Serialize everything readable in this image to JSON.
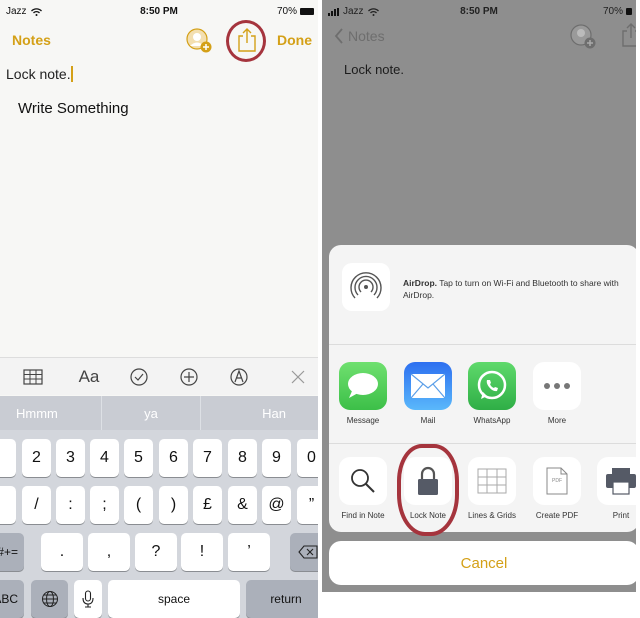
{
  "left_screen": {
    "status_bar": {
      "carrier": "Jazz",
      "time": "8:50 PM",
      "battery": "70%"
    },
    "navbar": {
      "back_label": "Notes",
      "done_label": "Done"
    },
    "note": {
      "title": "Lock note.",
      "body": "Write Something"
    },
    "toolbar": {
      "format_label": "Aa"
    },
    "suggestions": [
      "Hmmm",
      "ya",
      "Han"
    ],
    "keyboard": {
      "row1": [
        "2",
        "3",
        "4",
        "5",
        "6",
        "7",
        "8",
        "9",
        "0"
      ],
      "row2": [
        "/",
        ":",
        ";",
        "(",
        ")",
        "£",
        "&",
        "@",
        "”"
      ],
      "row3": [
        ".",
        ",",
        "?",
        "!",
        "’"
      ],
      "symbols_key": "#+=",
      "abc_key": "ABC",
      "space_key": "space",
      "return_key": "return"
    }
  },
  "right_screen": {
    "status_bar": {
      "carrier": "Jazz",
      "time": "8:50 PM",
      "battery": "70%"
    },
    "navbar": {
      "back_label": "Notes"
    },
    "note": {
      "title": "Lock note."
    },
    "share_sheet": {
      "airdrop_title": "AirDrop.",
      "airdrop_text": " Tap to turn on Wi-Fi and Bluetooth to share with AirDrop.",
      "apps": [
        {
          "label": "Message",
          "icon": "message-icon",
          "color": "#4cd964"
        },
        {
          "label": "Mail",
          "icon": "mail-icon",
          "color": "#1d7cf2"
        },
        {
          "label": "WhatsApp",
          "icon": "whatsapp-icon",
          "color": "#43c553"
        },
        {
          "label": "More",
          "icon": "more-icon",
          "color": "#ffffff"
        }
      ],
      "actions": [
        {
          "label": "Find in Note",
          "icon": "search-icon"
        },
        {
          "label": "Lock Note",
          "icon": "lock-icon"
        },
        {
          "label": "Lines & Grids",
          "icon": "grid-icon"
        },
        {
          "label": "Create PDF",
          "icon": "pdf-icon"
        },
        {
          "label": "Print",
          "icon": "printer-icon"
        }
      ],
      "pdf_glyph": "PDF",
      "cancel_label": "Cancel"
    }
  },
  "colors": {
    "accent": "#d4a017",
    "annotation": "#a5343d"
  }
}
